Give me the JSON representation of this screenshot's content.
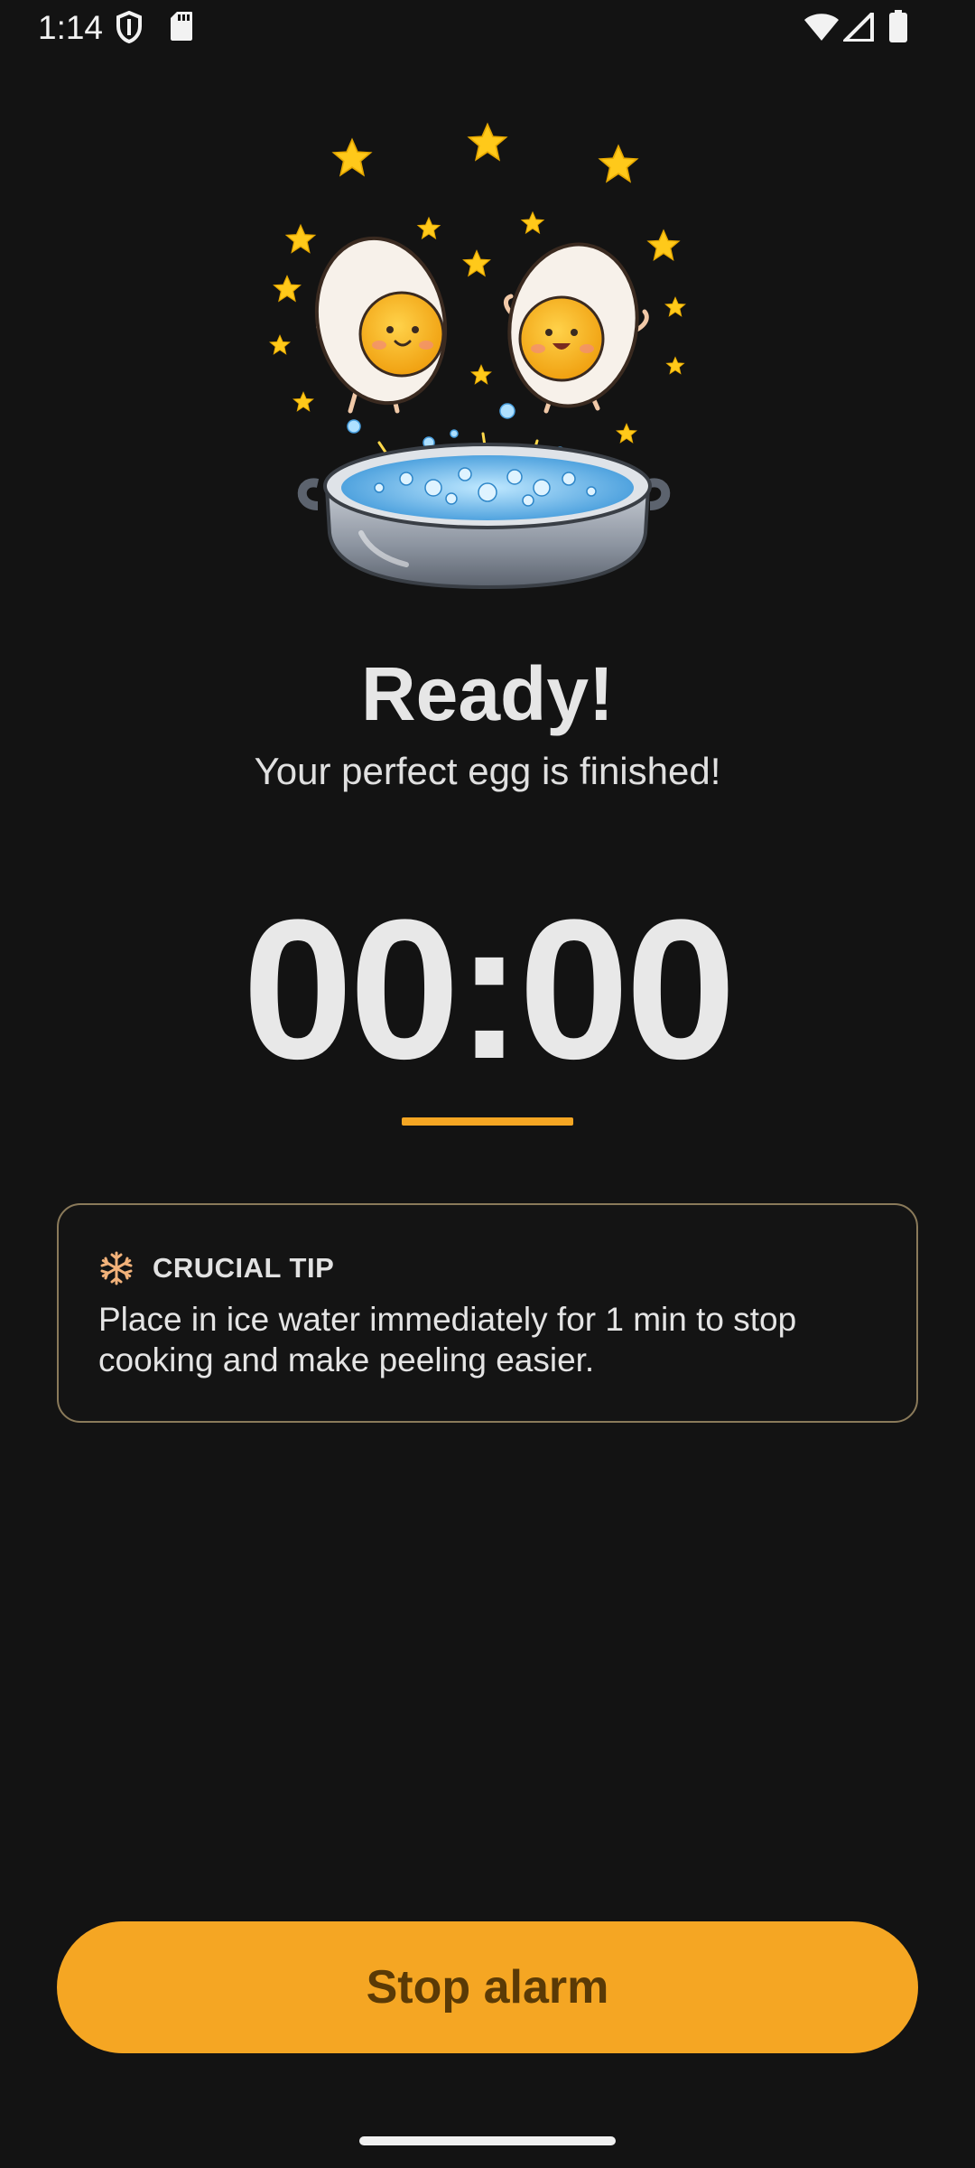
{
  "status_bar": {
    "time": "1:14",
    "icons": [
      "shield-icon",
      "sd-card-icon",
      "wifi-icon",
      "signal-icon",
      "battery-icon"
    ]
  },
  "illustration": {
    "name": "boiling-eggs-illustration"
  },
  "main": {
    "title": "Ready!",
    "subtitle": "Your perfect egg is finished!",
    "timer": "00:00"
  },
  "tip": {
    "icon": "snowflake-icon",
    "label": "CRUCIAL TIP",
    "text": "Place in ice water immediately for 1 min to stop cooking and make peeling easier."
  },
  "actions": {
    "stop_label": "Stop alarm"
  },
  "colors": {
    "background": "#131313",
    "accent": "#f5a623",
    "button_text": "#5a3a06",
    "card_border": "#8a7a5a"
  }
}
